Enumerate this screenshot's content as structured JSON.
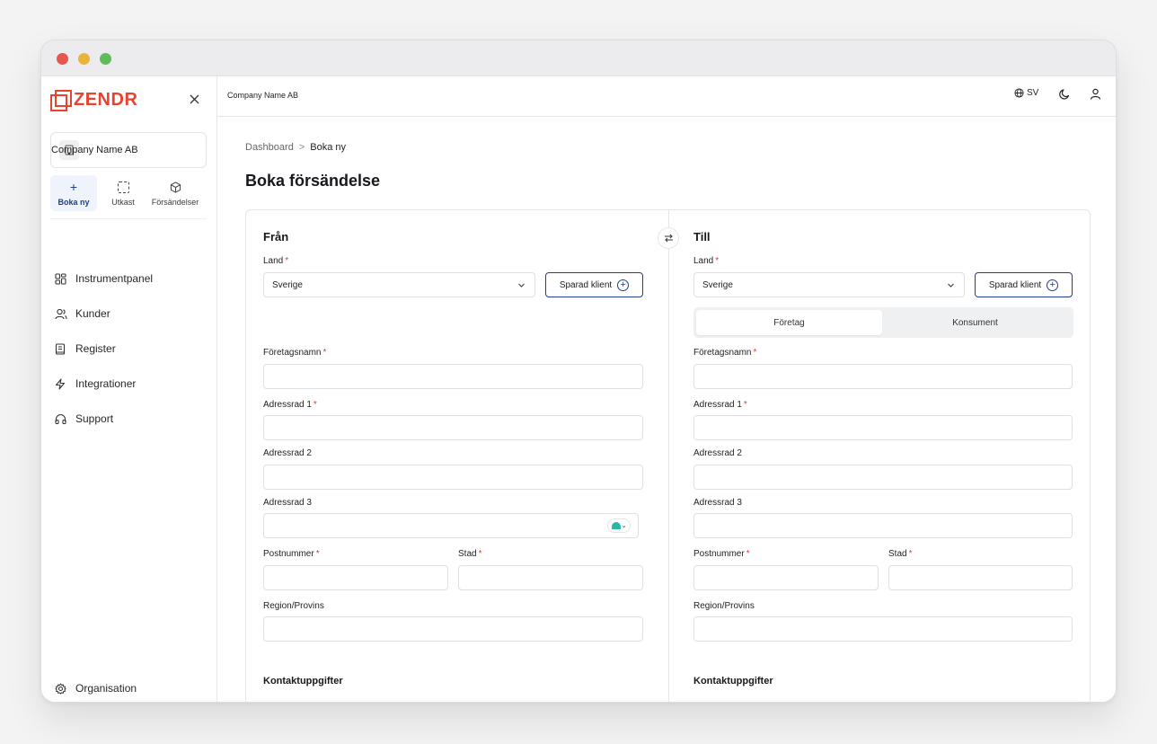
{
  "sidebar": {
    "logo_text": "ZENDR",
    "company": "Company Name AB",
    "quick_actions": [
      {
        "label": "Boka ny",
        "icon": "plus-icon"
      },
      {
        "label": "Utkast",
        "icon": "draft-icon"
      },
      {
        "label": "Försändelser",
        "icon": "package-icon"
      }
    ],
    "nav": [
      {
        "label": "Instrumentpanel",
        "icon": "dashboard-icon"
      },
      {
        "label": "Kunder",
        "icon": "users-icon"
      },
      {
        "label": "Register",
        "icon": "book-icon"
      },
      {
        "label": "Integrationer",
        "icon": "lightning-icon"
      },
      {
        "label": "Support",
        "icon": "headphones-icon"
      }
    ],
    "org_label": "Organisation"
  },
  "topbar": {
    "company": "Company Name AB",
    "language": "SV"
  },
  "breadcrumb": {
    "root": "Dashboard",
    "separator": ">",
    "current": "Boka ny"
  },
  "page": {
    "title": "Boka försändelse"
  },
  "from": {
    "title": "Från",
    "country_label": "Land",
    "country_value": "Sverige",
    "saved_client": "Sparad klient",
    "company_label": "Företagsnamn",
    "addr1_label": "Adressrad 1",
    "addr2_label": "Adressrad 2",
    "addr3_label": "Adressrad 3",
    "postal_label": "Postnummer",
    "city_label": "Stad",
    "region_label": "Region/Provins",
    "contact_title": "Kontaktuppgifter",
    "required_mark": "*"
  },
  "to": {
    "title": "Till",
    "country_label": "Land",
    "country_value": "Sverige",
    "saved_client": "Sparad klient",
    "segment": [
      "Företag",
      "Konsument"
    ],
    "company_label": "Företagsnamn",
    "addr1_label": "Adressrad 1",
    "addr2_label": "Adressrad 2",
    "addr3_label": "Adressrad 3",
    "postal_label": "Postnummer",
    "city_label": "Stad",
    "region_label": "Region/Provins",
    "contact_title": "Kontaktuppgifter",
    "required_mark": "*"
  },
  "colors": {
    "brand": "#e8432f",
    "accent": "#1e3f8a",
    "required": "#e03b3b"
  }
}
